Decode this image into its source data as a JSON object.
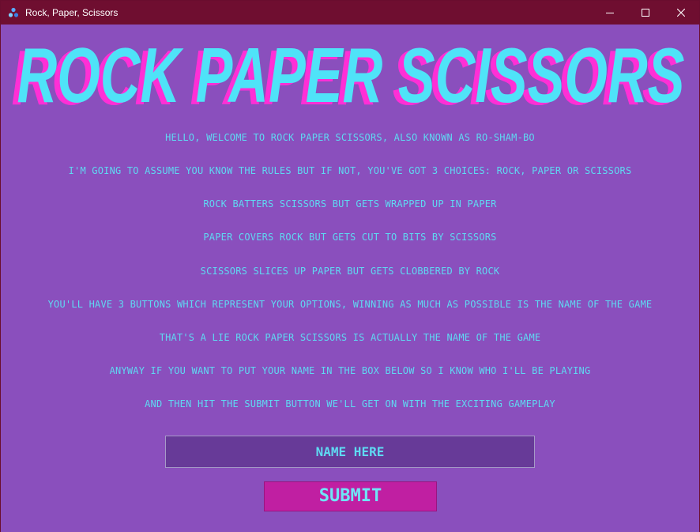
{
  "window": {
    "title": "Rock, Paper, Scissors",
    "icon": "rps-app-icon",
    "controls": [
      "minimize-icon",
      "maximize-icon",
      "close-icon"
    ]
  },
  "logo": {
    "text": "ROCK PAPER SCISSORS",
    "fill_color": "#4fe3f8",
    "shadow_color": "#ff2fd6"
  },
  "intro": {
    "lines": [
      "HELLO, WELCOME TO ROCK PAPER SCISSORS, ALSO KNOWN AS RO-SHAM-BO",
      "I'M GOING TO ASSUME YOU KNOW THE RULES BUT IF NOT, YOU'VE GOT 3 CHOICES: ROCK, PAPER OR SCISSORS",
      "ROCK BATTERS SCISSORS BUT GETS WRAPPED UP IN PAPER",
      "PAPER COVERS ROCK BUT GETS CUT TO BITS BY SCISSORS",
      "SCISSORS SLICES UP PAPER BUT GETS CLOBBERED BY ROCK",
      "YOU'LL HAVE 3 BUTTONS WHICH REPRESENT YOUR OPTIONS, WINNING AS MUCH AS POSSIBLE IS THE NAME OF THE GAME",
      "THAT'S A LIE ROCK PAPER SCISSORS IS ACTUALLY THE NAME OF THE GAME",
      "ANYWAY IF YOU WANT TO PUT YOUR NAME IN THE BOX BELOW SO I KNOW WHO I'LL BE PLAYING",
      "AND THEN HIT THE SUBMIT BUTTON WE'LL GET ON WITH THE EXCITING GAMEPLAY"
    ]
  },
  "form": {
    "name_placeholder": "NAME HERE",
    "name_value": "",
    "submit_label": "SUBMIT"
  },
  "colors": {
    "background": "#8a4fbd",
    "titlebar": "#6f0e30",
    "text": "#5fd9f2",
    "input_bg": "#673a98",
    "submit_bg": "#c01fa2"
  }
}
